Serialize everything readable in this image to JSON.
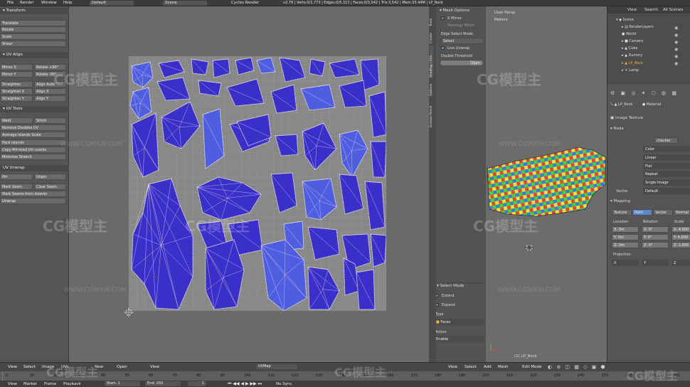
{
  "topmenu": {
    "file": "File",
    "render": "Render",
    "window": "Window",
    "help": "Help",
    "layout": "Default",
    "scene": "Scene",
    "engine": "Cycles Render",
    "stats": "v2.79 | Verts:0/1,773 | Edges:0/5,313 | Faces:0/3,542 | Tris:3,542 | Mem:33.44M | LP_Rock"
  },
  "left": {
    "transform_header": "Transform",
    "translate": "Translate",
    "rotate": "Rotate",
    "scale": "Scale",
    "shear": "Shear",
    "uvalign_header": "UV Align",
    "mirror_x": "Mirror X",
    "rotate_p90": "Rotate +90°",
    "mirror_y": "Mirror Y",
    "rotate_m90": "Rotate -90°",
    "straighten": "Straighten",
    "align_auto": "Align Auto",
    "straighten_x": "Straighten X",
    "align_x": "Align X",
    "straighten_y": "Straighten Y",
    "align_y": "Align Y",
    "uvtools_header": "UV Tools",
    "weld": "Weld",
    "stitch": "Stitch",
    "remove_doubles": "Remove Doubles UV",
    "average_islands": "Average Islands Scale",
    "pack_islands": "Pack Islands",
    "copy_mirrored": "Copy Mirrored UV coords",
    "minimize_stretch": "Minimize Stretch",
    "uvunwrap_header": "UV Unwrap",
    "pin": "Pin",
    "unpin": "Unpin",
    "mark_seam": "Mark Seam",
    "clear_seam": "Clear Seam",
    "mark_seams_islands": "Mark Seams from Islands",
    "unwrap": "Unwrap"
  },
  "uv_editor_bottom": {
    "view": "View",
    "select": "Select",
    "image": "Image",
    "uvs": "UVs",
    "new": "New",
    "open": "Open",
    "view2": "View",
    "uvmap": "UVMap"
  },
  "mesh_options": {
    "header": "Mesh Options",
    "x_mirror": "X Mirror",
    "topology_mirror": "Topology Mirror",
    "edge_select_mode": "Edge Select Mode",
    "select": "Select",
    "live_unwrap": "Live Unwrap",
    "double_threshold": "Double Threshold",
    "threshold_value": "10μm",
    "tabs": [
      "Tools",
      "Create",
      "Shading / UVs",
      "Options",
      "Grease Pencil"
    ],
    "select_mode_header": "Select Mode",
    "extend": "Extend",
    "expand": "Expand",
    "type_label": "Type",
    "type_value": "Faces",
    "action_label": "Action",
    "action_value": "Enable"
  },
  "viewport": {
    "persp": "User Persp",
    "units": "Meters",
    "object_label": "(1) LP_Rock",
    "view": "View",
    "select": "Select",
    "add": "Add",
    "mesh": "Mesh",
    "mode": "Edit Mode"
  },
  "outliner": {
    "view": "View",
    "search": "Search",
    "all_scenes": "All Scenes",
    "items": [
      "Scene",
      "RenderLayers",
      "World",
      "Camera",
      "Cube",
      "Dummy",
      "LP_Rock",
      "Lamp"
    ]
  },
  "properties": {
    "object": "LP_Rock",
    "material": "Material",
    "image_texture": "Image Texture",
    "node_header": "Node",
    "checker": "checker",
    "color": "Color",
    "linear": "Linear",
    "flat": "Flat",
    "repeat": "Repeat",
    "single_image": "Single Image",
    "vector_label": "Vector:",
    "vector_value": "Default",
    "mapping_header": "Mapping",
    "tabs": [
      "Texture",
      "Point",
      "Vector",
      "Normal"
    ],
    "location": "Location",
    "rotation": "Rotation",
    "scale": "Scale",
    "loc_x": "X: 0m",
    "loc_y": "Y: 0m",
    "loc_z": "Z: 0m",
    "rot_x": "X: 0°",
    "rot_y": "Y: 0°",
    "rot_z": "Z: 0°",
    "sc_x": "X: 4.000",
    "sc_y": "Y: 4.000",
    "sc_z": "Z: 1.000",
    "projection": "Projection",
    "proj_x": "X",
    "proj_y": "Y",
    "proj_z": "Z"
  },
  "timeline": {
    "view": "View",
    "marker": "Marker",
    "frame": "Frame",
    "playback": "Playback",
    "start": "Start:",
    "start_val": "1",
    "end": "End:",
    "end_val": "250",
    "current": "1",
    "sync": "No Sync"
  },
  "ruler_ticks": [
    "0",
    "10",
    "20",
    "30",
    "40",
    "50",
    "60",
    "70",
    "80",
    "90",
    "100",
    "110",
    "120",
    "130",
    "140",
    "150",
    "160",
    "170",
    "180",
    "190",
    "200",
    "210",
    "220",
    "230",
    "240",
    "250",
    "260",
    "270",
    "280"
  ],
  "watermarks": {
    "logo": "CG模型主",
    "site": "WWW.CGMXW.COM"
  },
  "colors": {
    "island_fill": "#3a2fc9",
    "island_light": "#4f5de0",
    "wire": "#e8e8e8",
    "panel": "#555555"
  }
}
